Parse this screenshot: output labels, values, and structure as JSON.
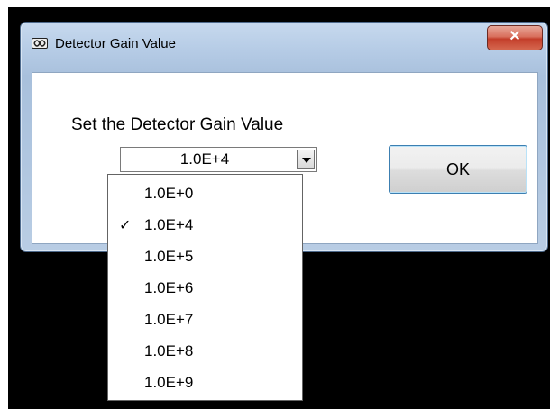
{
  "window": {
    "title": "Detector Gain Value",
    "close_label": "✕",
    "icon": "app-icon"
  },
  "dialog": {
    "prompt": "Set the Detector Gain Value",
    "selected_value": "1.0E+4",
    "ok_label": "OK"
  },
  "dropdown": {
    "options": [
      "1.0E+0",
      "1.0E+4",
      "1.0E+5",
      "1.0E+6",
      "1.0E+7",
      "1.0E+8",
      "1.0E+9"
    ],
    "checked_index": 1,
    "check_mark": "✓"
  }
}
